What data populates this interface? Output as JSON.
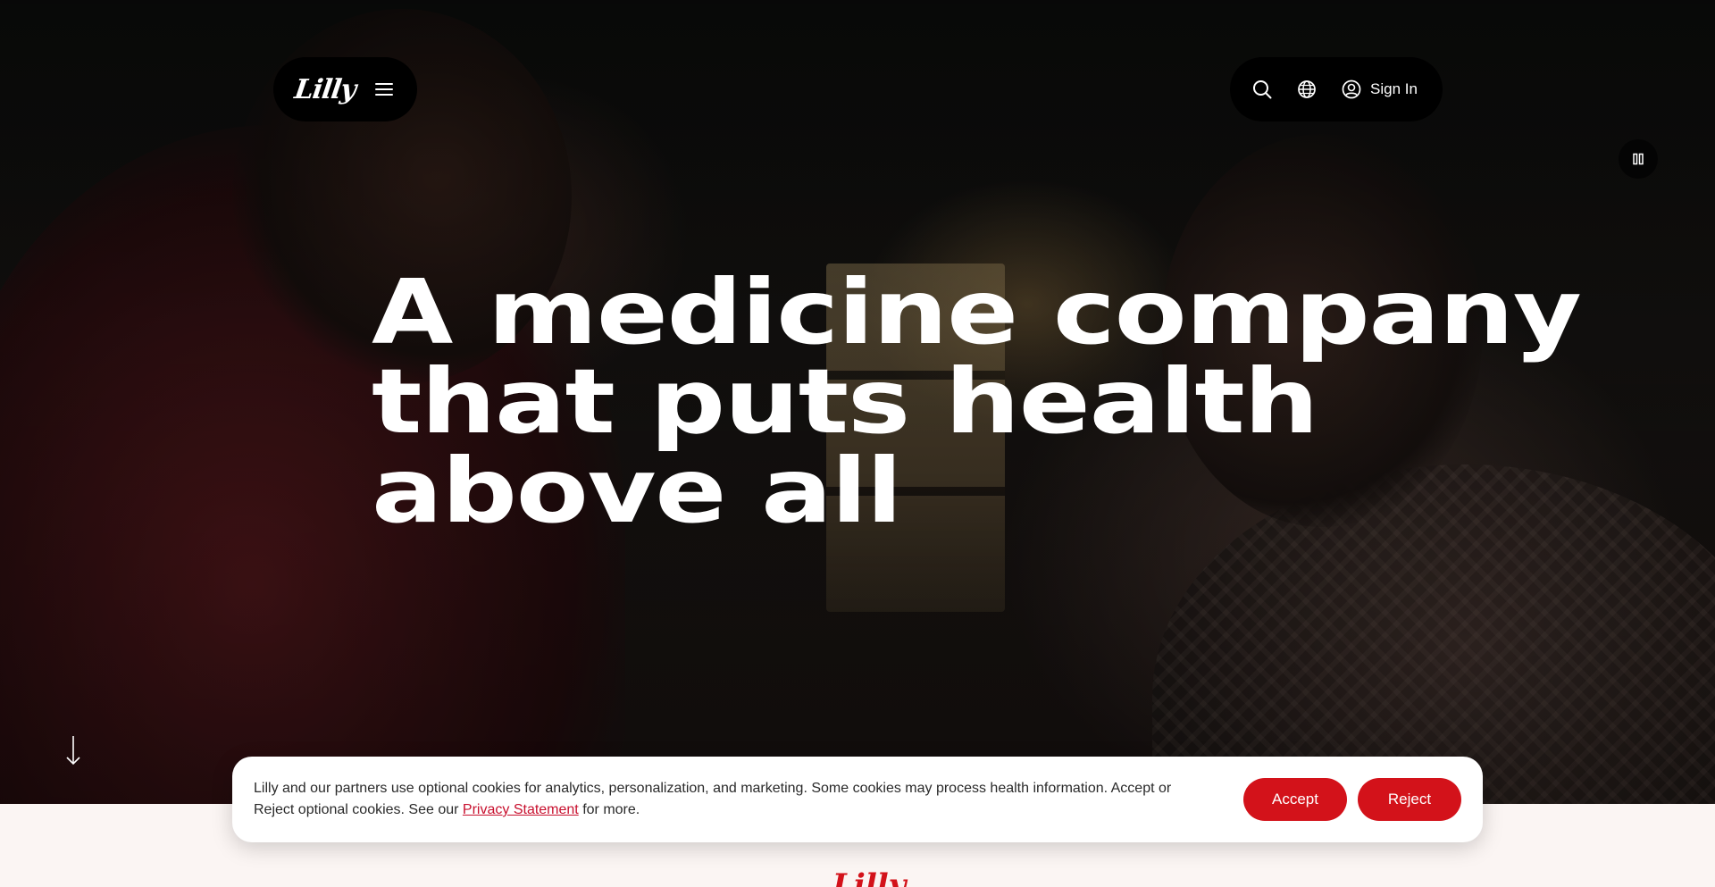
{
  "brand": {
    "logo_text": "Lilly",
    "accent_color": "#d3121a"
  },
  "nav": {
    "menu_icon": "hamburger-icon",
    "search_icon": "search-icon",
    "language_icon": "globe-icon",
    "account_icon": "user-circle-icon",
    "signin_label": "Sign In"
  },
  "hero": {
    "headline_lines": [
      "A medicine company",
      "that puts health",
      "above all"
    ],
    "pause_icon": "pause-icon",
    "scroll_icon": "arrow-down-icon"
  },
  "cookie_banner": {
    "text_before_link": "Lilly and our partners use optional cookies for analytics, personalization, and marketing. Some cookies may process health information. Accept or Reject optional cookies. See our ",
    "link_text": "Privacy Statement",
    "text_after_link": " for more.",
    "accept_label": "Accept",
    "reject_label": "Reject"
  },
  "footer": {
    "logo_text": "Lilly"
  }
}
